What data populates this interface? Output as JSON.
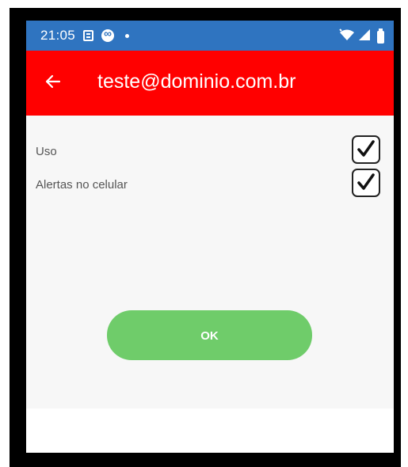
{
  "status_bar": {
    "time": "21:05",
    "icons": [
      "notification-icon",
      "loop-icon",
      "dot-icon",
      "wifi-icon",
      "signal-icon",
      "battery-icon"
    ],
    "color": "#2f74c0"
  },
  "app_bar": {
    "title": "teste@dominio.com.br",
    "back_icon": "arrow-left-icon",
    "color": "#ff0000"
  },
  "preferences": [
    {
      "label": "Uso",
      "checked": true
    },
    {
      "label": "Alertas no celular",
      "checked": true
    }
  ],
  "ok_button": {
    "label": "OK",
    "color": "#6fcc6a"
  }
}
